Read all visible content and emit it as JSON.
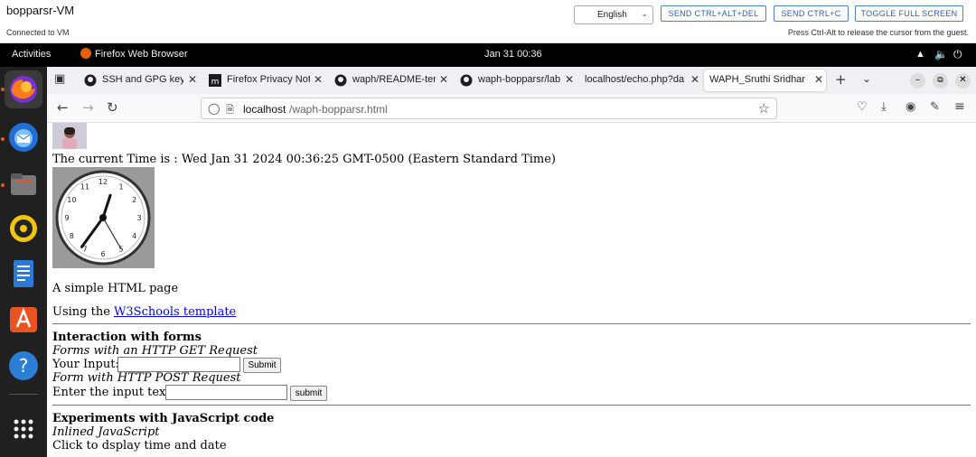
{
  "vm": {
    "name": "bopparsr-VM",
    "status": "Connected to VM",
    "language": "English",
    "buttons": {
      "ctrl_alt_del": "SEND CTRL+ALT+DEL",
      "ctrl_c": "SEND CTRL+C",
      "fullscreen": "TOGGLE FULL SCREEN"
    },
    "hint": "Press Ctrl-Alt to release the cursor from the guest."
  },
  "topbar": {
    "activities": "Activities",
    "app": "Firefox Web Browser",
    "clock": "Jan 31  00:36"
  },
  "tabs": [
    {
      "label": "SSH and GPG keys",
      "icon": "github-icon"
    },
    {
      "label": "Firefox Privacy Not",
      "icon": "mozilla-icon"
    },
    {
      "label": "waph/README-ter",
      "icon": "github-icon"
    },
    {
      "label": "waph-bopparsr/lab",
      "icon": "github-icon"
    },
    {
      "label": "localhost/echo.php?da",
      "icon": "none"
    },
    {
      "label": "WAPH_Sruthi Sridhar",
      "icon": "none"
    }
  ],
  "url": {
    "host": "localhost",
    "path": "/waph-bopparsr.html"
  },
  "page": {
    "time_text": "The current Time is : Wed Jan 31 2024 00:36:25 GMT-0500 (Eastern Standard Time)",
    "clock_numbers": [
      "12",
      "1",
      "2",
      "3",
      "4",
      "5",
      "6",
      "7",
      "8",
      "9",
      "10",
      "11"
    ],
    "simple": "A simple HTML page",
    "using_prefix": "Using the ",
    "using_link": "W3Schools template",
    "forms_heading": "Interaction with forms",
    "get_caption": "Forms with an HTTP GET Request",
    "your_input": "Your Input:",
    "submit_get": "Submit",
    "post_caption": "Form with HTTP POST Request",
    "enter_text": "Enter the input text",
    "submit_post": "submit",
    "js_heading": "Experiments with JavaScript code",
    "inline_js": "Inlined JavaScript",
    "click_text": "Click to dsplay time and date"
  },
  "colors": {
    "accent": "#2a5fb8",
    "link": "#0000ee",
    "dock": "#202020",
    "topbar": "#000000"
  }
}
